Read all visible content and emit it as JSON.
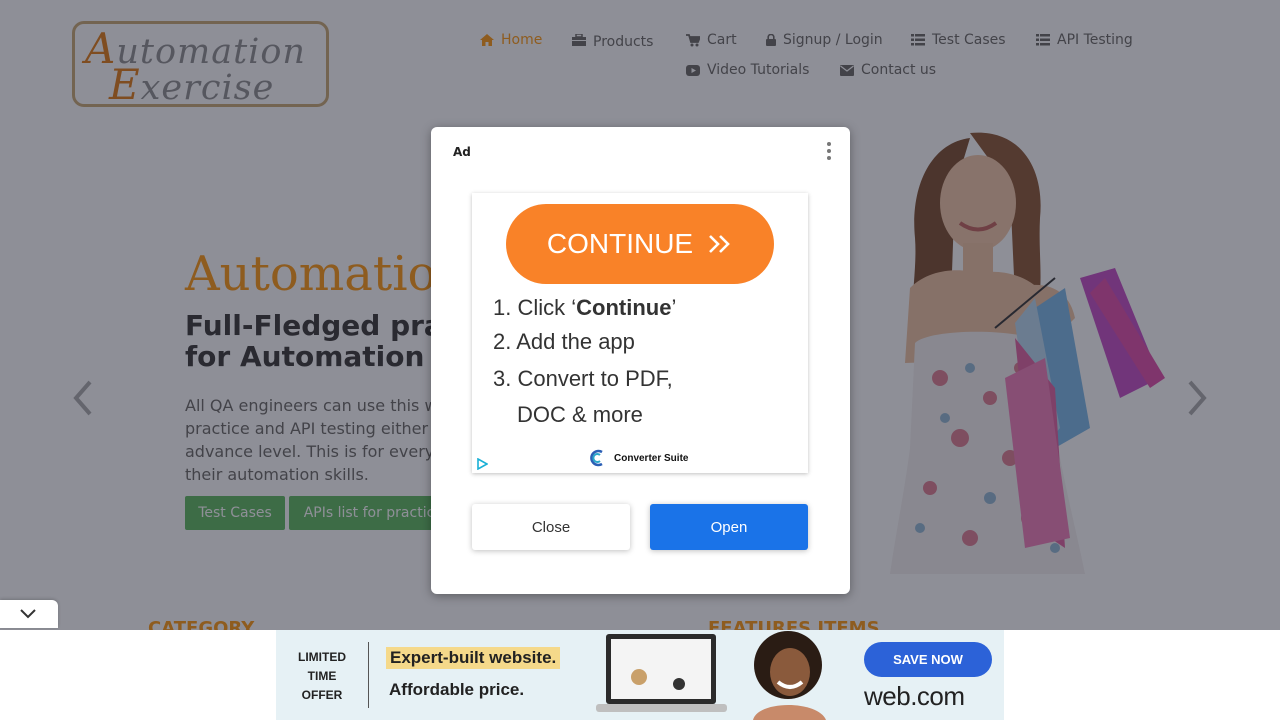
{
  "logo": {
    "line1_cap": "A",
    "line1_rest": "utomation",
    "line2_cap": "E",
    "line2_rest": "xercise"
  },
  "nav": {
    "items": [
      {
        "label": "Home",
        "icon": "home-icon",
        "active": true
      },
      {
        "label": "Products",
        "icon": "products-icon"
      },
      {
        "label": "Cart",
        "icon": "cart-icon"
      },
      {
        "label": "Signup / Login",
        "icon": "lock-icon"
      },
      {
        "label": "Test Cases",
        "icon": "list-icon"
      },
      {
        "label": "API Testing",
        "icon": "list-icon"
      },
      {
        "label": "Video Tutorials",
        "icon": "youtube-icon"
      },
      {
        "label": "Contact us",
        "icon": "envelope-icon"
      }
    ]
  },
  "hero": {
    "title": "Automatio",
    "subtitle_line1": "Full-Fledged pra",
    "subtitle_line2": "for Automation",
    "desc_line1": "All QA engineers can use this w",
    "desc_line2": "practice and API testing either",
    "desc_line3": "advance level. This is for every",
    "desc_line4": "their automation skills.",
    "btn_test_cases": "Test Cases",
    "btn_apis": "APIs list for practic"
  },
  "sections": {
    "category": "CATEGORY",
    "features": "FEATURES ITEMS"
  },
  "modal": {
    "ad_label": "Ad",
    "continue_label": "CONTINUE",
    "step1_prefix": "1. Click ‘",
    "step1_bold": "Continue",
    "step1_suffix": "’",
    "step2": "2. Add the app",
    "step3a": "3. Convert to PDF,",
    "step3b": "DOC & more",
    "brand": "Converter Suite",
    "close_label": "Close",
    "open_label": "Open"
  },
  "bottom_ad": {
    "offer_line1": "LIMITED",
    "offer_line2": "TIME",
    "offer_line3": "OFFER",
    "headline1": "Expert-built website.",
    "headline2": "Affordable price.",
    "cta": "SAVE NOW",
    "brand": "web.com"
  },
  "colors": {
    "accent": "#fe980f",
    "green": "#5cb85c",
    "open_blue": "#1a73e8",
    "continue_orange": "#f98228"
  }
}
